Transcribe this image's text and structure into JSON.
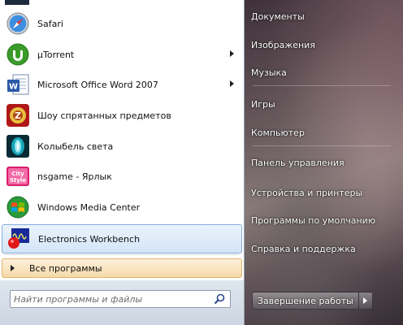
{
  "programs": [
    {
      "label": "Safari",
      "icon": "safari-icon",
      "submenu": false
    },
    {
      "label": "µTorrent",
      "icon": "utorrent-icon",
      "submenu": true
    },
    {
      "label": "Microsoft Office Word 2007",
      "icon": "word-icon",
      "submenu": true
    },
    {
      "label": "Шоу спрятанных предметов",
      "icon": "hidden-objects-game-icon",
      "submenu": false
    },
    {
      "label": "Колыбель света",
      "icon": "colybel-sveta-game-icon",
      "submenu": false
    },
    {
      "label": "nsgame - Ярлык",
      "icon": "nsgame-icon",
      "submenu": false
    },
    {
      "label": "Windows Media Center",
      "icon": "windows-media-center-icon",
      "submenu": false
    },
    {
      "label": "Electronics Workbench",
      "icon": "electronics-workbench-icon",
      "submenu": false,
      "highlighted": true
    }
  ],
  "all_programs": {
    "label": "Все программы"
  },
  "search": {
    "placeholder": "Найти программы и файлы"
  },
  "places": [
    "Документы",
    "Изображения",
    "Музыка",
    "Игры",
    "Компьютер",
    "Панель управления",
    "Устройства и принтеры",
    "Программы по умолчанию",
    "Справка и поддержка"
  ],
  "shutdown": {
    "label": "Завершение работы"
  },
  "colors": {
    "highlight_bg": "#d4e5f7",
    "highlight_border": "#84acd8",
    "all_programs_bg": "#f6d9a9",
    "utorrent_green": "#3a9a2a",
    "word_blue": "#2a5aa8"
  }
}
